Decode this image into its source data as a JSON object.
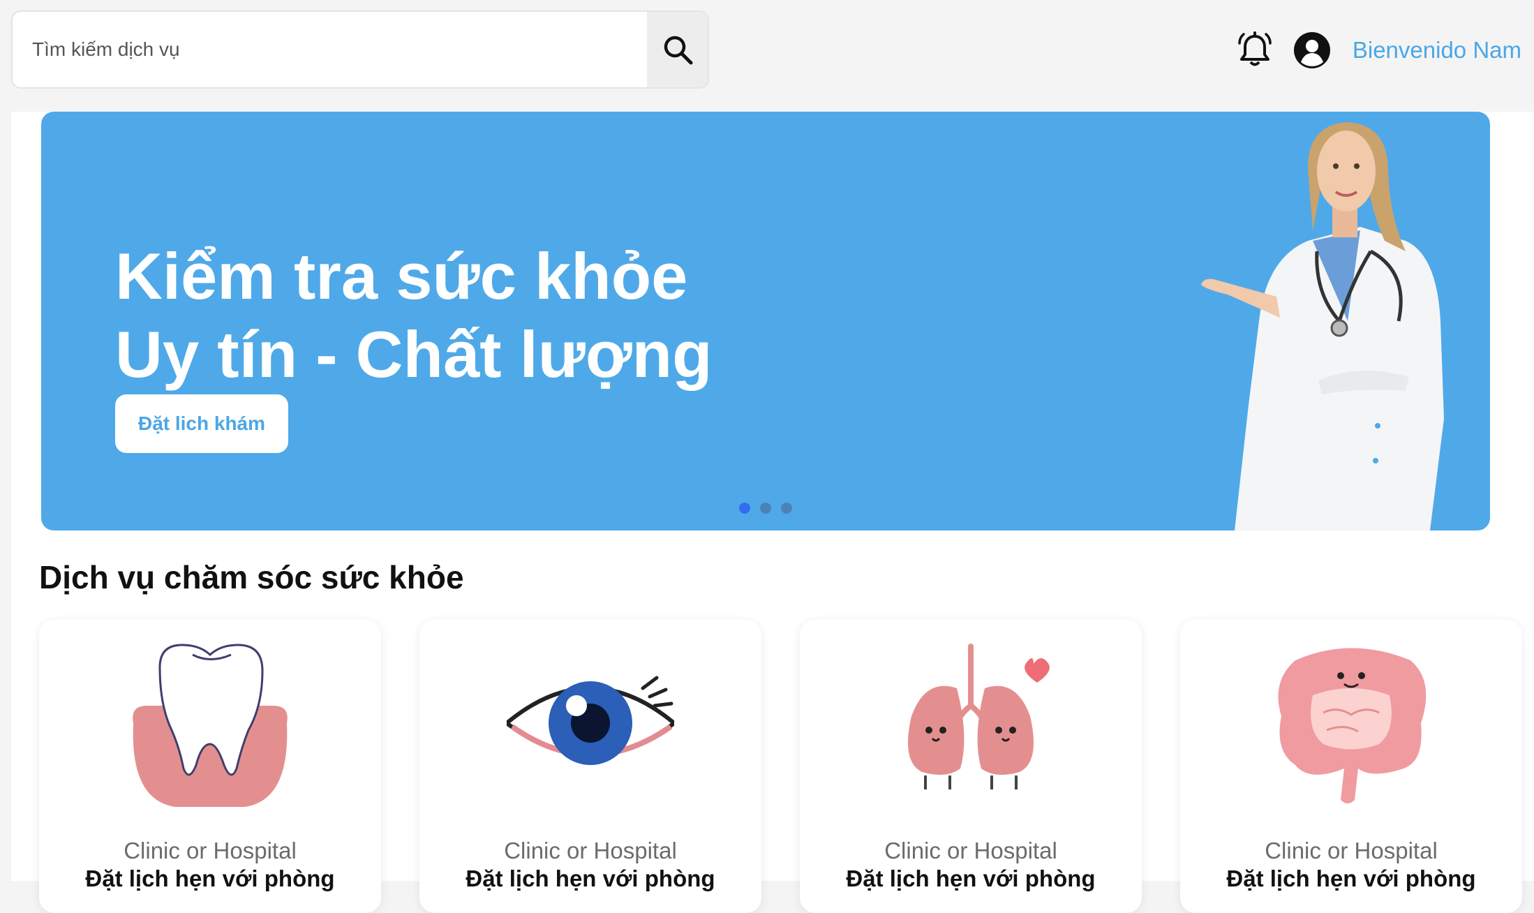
{
  "header": {
    "search_placeholder": "Tìm kiếm dịch vụ",
    "welcome_text": "Bienvenido Nam",
    "icons": [
      "search-icon",
      "bell-icon",
      "user-avatar-icon"
    ]
  },
  "banner": {
    "title_line1": "Kiểm tra sức khỏe",
    "title_line2": "Uy tín - Chất lượng",
    "button_label": "Đặt lich khám",
    "slides": 3,
    "active_slide": 1,
    "background_color": "#4fa9e8"
  },
  "services": {
    "title": "Dịch vụ chăm sóc sức khỏe",
    "cards": [
      {
        "icon": "tooth-icon",
        "subtitle": "Clinic or Hospital",
        "name": "Đặt lịch hẹn với phòng"
      },
      {
        "icon": "eye-icon",
        "subtitle": "Clinic or Hospital",
        "name": "Đặt lịch hẹn với phòng"
      },
      {
        "icon": "lungs-icon",
        "subtitle": "Clinic or Hospital",
        "name": "Đặt lịch hẹn với phòng"
      },
      {
        "icon": "intestine-icon",
        "subtitle": "Clinic or Hospital",
        "name": "Đặt lịch hẹn với phòng"
      }
    ]
  },
  "colors": {
    "accent": "#4ba6e6",
    "page_background": "#f4f4f4"
  }
}
